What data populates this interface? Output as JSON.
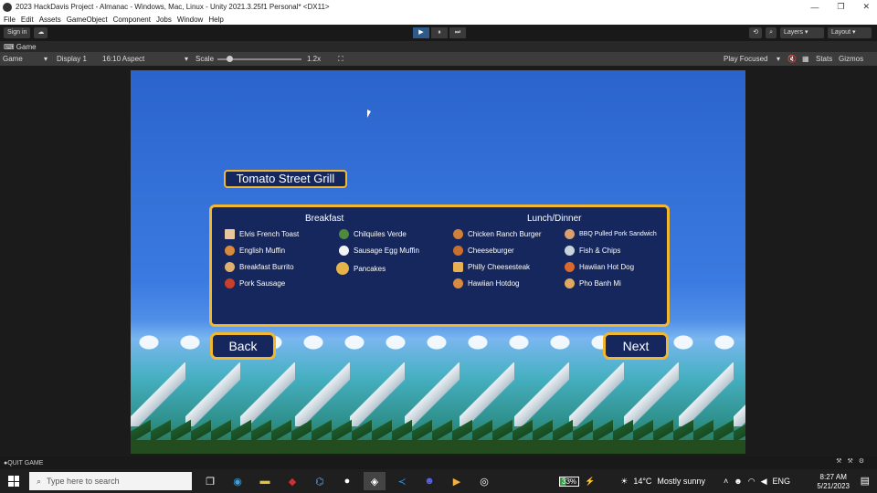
{
  "window": {
    "title": "2023 HackDavis Project - Almanac - Windows, Mac, Linux - Unity 2021.3.25f1 Personal* <DX11>",
    "controls": [
      "—",
      "❐",
      "✕"
    ]
  },
  "menu": [
    "File",
    "Edit",
    "Assets",
    "GameObject",
    "Component",
    "Jobs",
    "Window",
    "Help"
  ],
  "toolbar": {
    "sign_in": "Sign in",
    "cloud_icon": "cloud-icon",
    "play": "▶",
    "pause": "⏸",
    "step": "⏭",
    "layers": "Layers ▾",
    "layout": "Layout ▾"
  },
  "game_tab": {
    "label": "Game"
  },
  "game_controls": {
    "view": "Game",
    "display": "Display 1",
    "aspect": "16:10 Aspect",
    "scale_label": "Scale",
    "scale_value": "1.2x",
    "play_focused": "Play Focused",
    "stats": "Stats",
    "gizmos": "Gizmos"
  },
  "game": {
    "restaurant_title": "Tomato Street Grill",
    "breakfast_heading": "Breakfast",
    "lunch_heading": "Lunch/Dinner",
    "breakfast_col1": [
      "Elvis French Toast",
      "English Muffin",
      "Breakfast Burrito",
      "Pork Sausage"
    ],
    "breakfast_col2": [
      "Chilquiles Verde",
      "Sausage Egg Muffin",
      "Pancakes"
    ],
    "lunch_col1": [
      "Chicken Ranch Burger",
      "Cheeseburger",
      "Philly Cheesesteak",
      "Hawiian Hotdog"
    ],
    "lunch_col2": [
      "BBQ Pulled Pork Sandwich",
      "Fish & Chips",
      "Hawiian Hot Dog",
      "Pho Banh Mi"
    ],
    "back_label": "Back",
    "next_label": "Next"
  },
  "status": {
    "text": "QUIT GAME"
  },
  "taskbar": {
    "search_placeholder": "Type here to search",
    "battery": "33%",
    "temperature": "14°C",
    "weather": "Mostly sunny",
    "language": "ENG",
    "time": "8:27 AM",
    "date": "5/21/2023"
  }
}
